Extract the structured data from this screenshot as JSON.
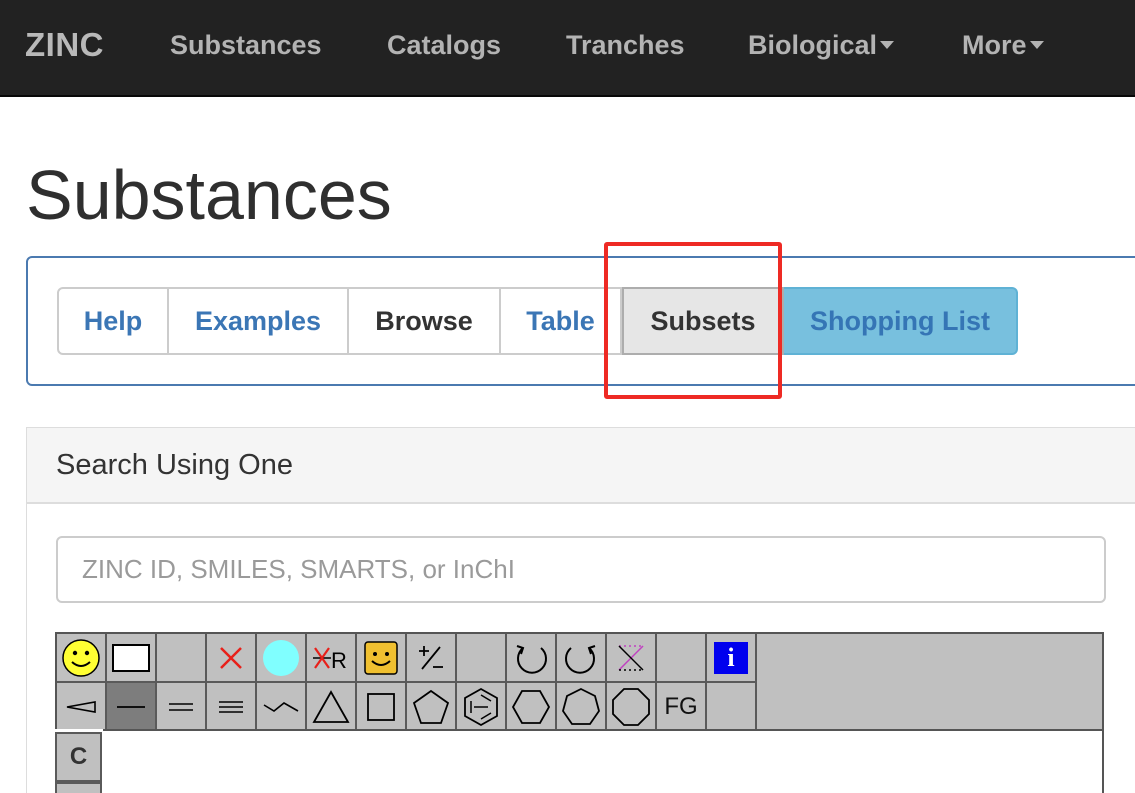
{
  "navbar": {
    "brand": "ZINC",
    "items": [
      {
        "label": "Substances"
      },
      {
        "label": "Catalogs"
      },
      {
        "label": "Tranches"
      },
      {
        "label": "Biological"
      },
      {
        "label": "More"
      }
    ]
  },
  "page": {
    "title": "Substances"
  },
  "tabs": [
    {
      "label": "Help"
    },
    {
      "label": "Examples"
    },
    {
      "label": "Browse"
    },
    {
      "label": "Table"
    },
    {
      "label": "Subsets"
    },
    {
      "label": "Shopping List"
    }
  ],
  "search": {
    "heading": "Search Using One",
    "placeholder": "ZINC ID, SMILES, SMARTS, or InChI"
  },
  "editor": {
    "row1_icons": [
      "smiley-icon",
      "rectangle-icon",
      "blank-icon",
      "delete-x-icon",
      "cyan-circle-icon",
      "delete-r-group-icon",
      "reaction-smiley-icon",
      "charge-plus-minus-icon",
      "blank-icon",
      "undo-icon",
      "redo-icon",
      "clear-icon",
      "blank-icon",
      "info-icon"
    ],
    "row2_icons": [
      "wedge-bond-icon",
      "single-bond-icon",
      "double-bond-icon",
      "triple-bond-icon",
      "chain-icon",
      "ring-3-icon",
      "ring-4-icon",
      "ring-5-icon",
      "benzene-icon",
      "ring-6-icon",
      "ring-7-icon",
      "ring-8-icon",
      "functional-group-icon",
      "blank-icon"
    ],
    "fg_label": "FG",
    "info_label": "i",
    "r_label": "R",
    "carbon_label": "C"
  },
  "colors": {
    "navbar_bg": "#222222",
    "link": "#3b76b5",
    "active_tab": "#e6e6e6",
    "info_button": "#78c0de",
    "highlight": "#ee2a24",
    "toolbar_bg": "#c0c0c0"
  }
}
